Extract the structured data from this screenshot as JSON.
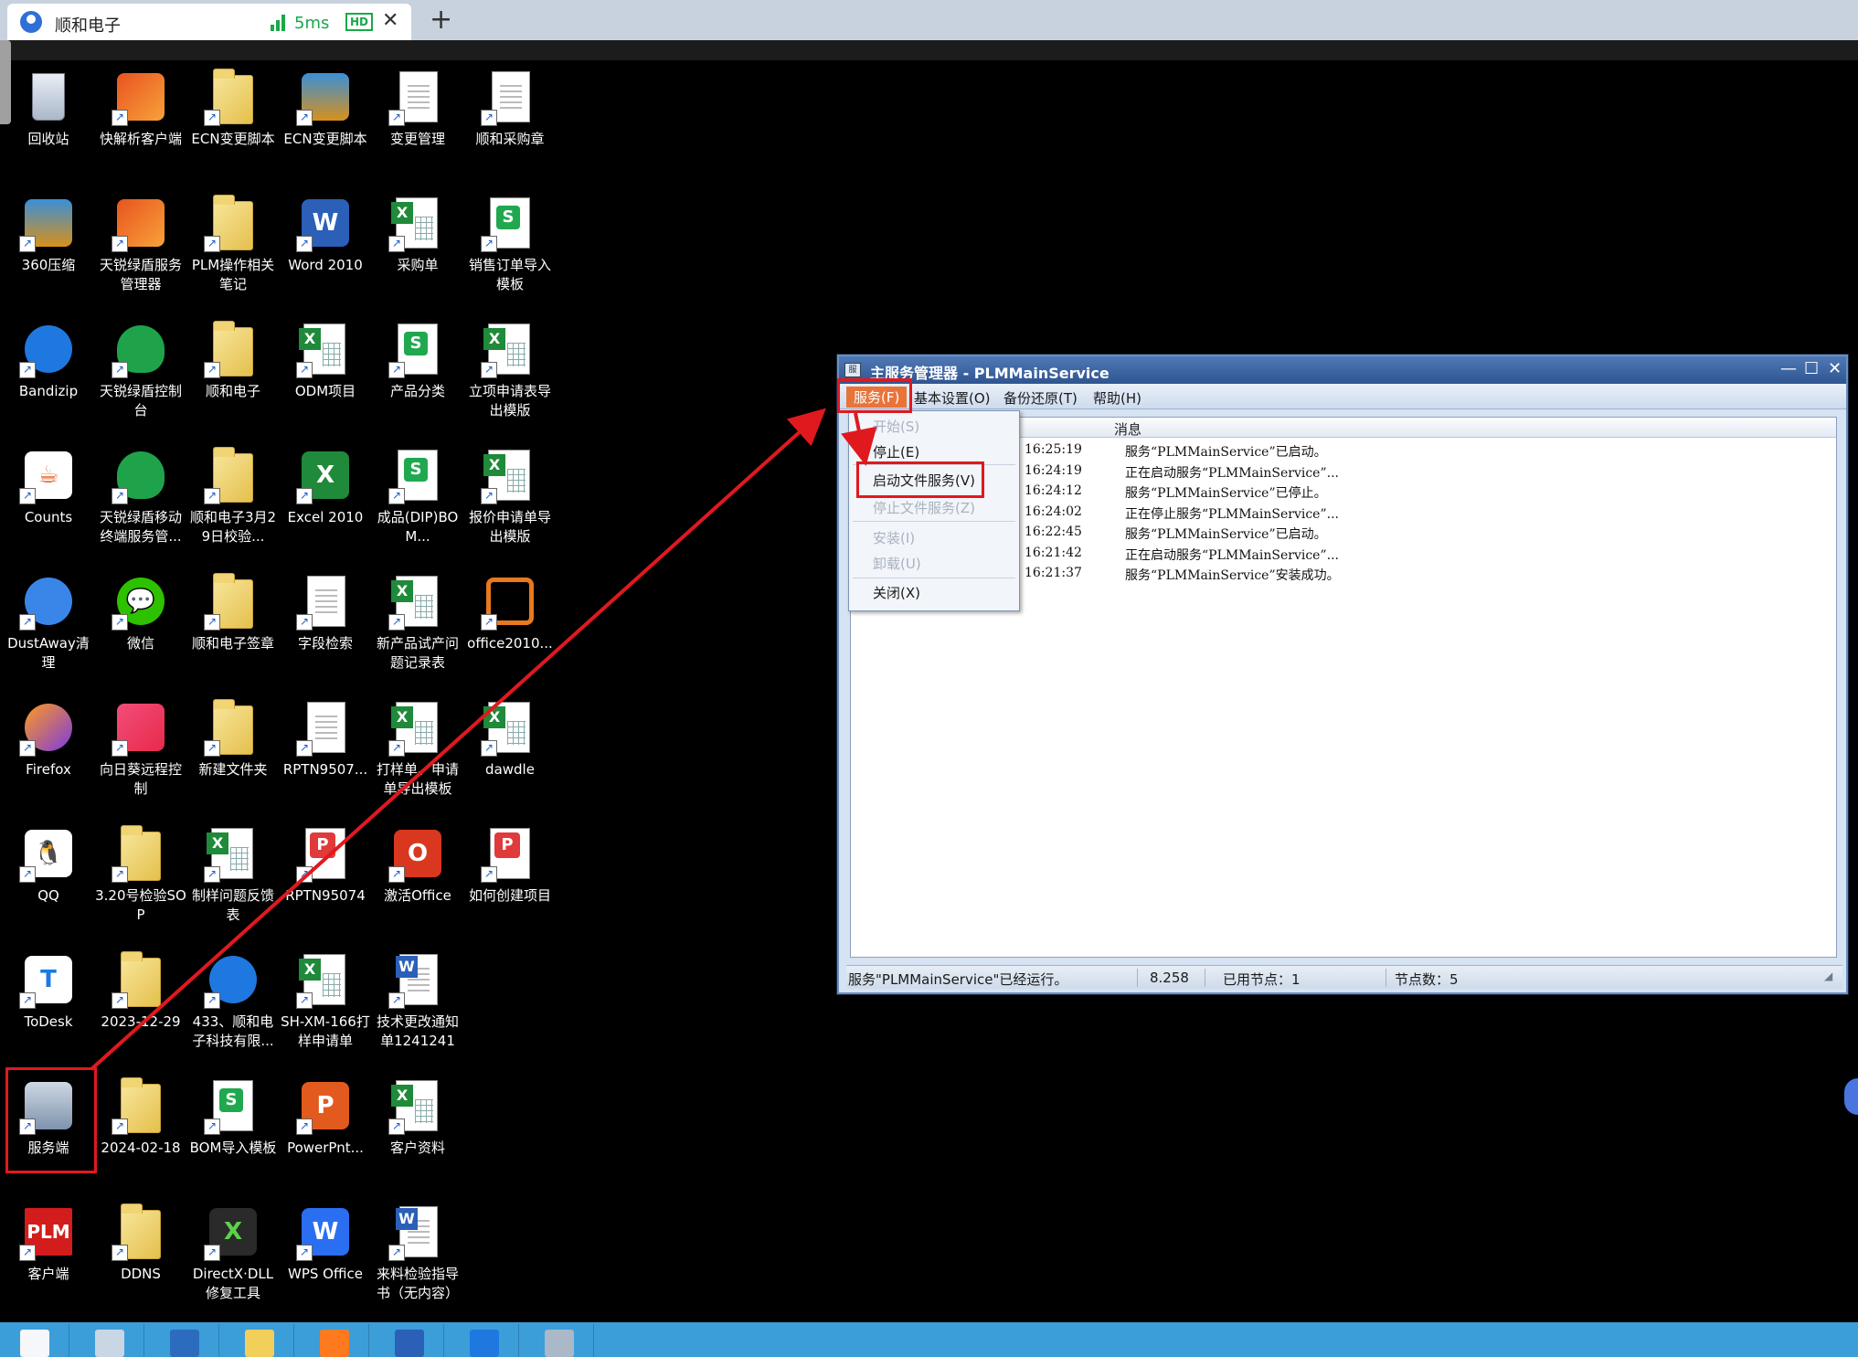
{
  "browser": {
    "tab_title": "顺和电子",
    "latency": "5ms",
    "hd_badge": "HD",
    "close_glyph": "✕",
    "new_tab_glyph": "+"
  },
  "desktop": {
    "icons": [
      {
        "label": "回收站",
        "type": "recycle"
      },
      {
        "label": "快解析客户端",
        "type": "app"
      },
      {
        "label": "ECN变更脚本",
        "type": "folder"
      },
      {
        "label": "ECN变更脚本",
        "type": "zip"
      },
      {
        "label": "变更管理",
        "type": "doc"
      },
      {
        "label": "顺和采购章",
        "type": "image"
      },
      {
        "label": "360压缩",
        "type": "zip"
      },
      {
        "label": "天锐绿盾服务管理器",
        "type": "app"
      },
      {
        "label": "PLM操作相关笔记",
        "type": "folder"
      },
      {
        "label": "Word 2010",
        "type": "word"
      },
      {
        "label": "采购单",
        "type": "xls"
      },
      {
        "label": "销售订单导入模板",
        "type": "wps"
      },
      {
        "label": "Bandizip",
        "type": "bandizip"
      },
      {
        "label": "天锐绿盾控制台",
        "type": "shield"
      },
      {
        "label": "顺和电子",
        "type": "folder"
      },
      {
        "label": "ODM项目",
        "type": "xls"
      },
      {
        "label": "产品分类",
        "type": "wps"
      },
      {
        "label": "立项申请表导出模版",
        "type": "xls"
      },
      {
        "label": "Counts",
        "type": "java"
      },
      {
        "label": "天锐绿盾移动终端服务管...",
        "type": "shield"
      },
      {
        "label": "顺和电子3月29日校验...",
        "type": "folder"
      },
      {
        "label": "Excel 2010",
        "type": "excel"
      },
      {
        "label": "成品(DIP)BOM...",
        "type": "wps"
      },
      {
        "label": "报价申请单导出模版",
        "type": "xls"
      },
      {
        "label": "DustAway清理",
        "type": "dust"
      },
      {
        "label": "微信",
        "type": "wechat"
      },
      {
        "label": "顺和电子签章",
        "type": "folder"
      },
      {
        "label": "字段检索",
        "type": "doc"
      },
      {
        "label": "新产品试产问题记录表",
        "type": "xls"
      },
      {
        "label": "office2010...",
        "type": "office2010"
      },
      {
        "label": "Firefox",
        "type": "firefox"
      },
      {
        "label": "向日葵远程控制",
        "type": "sunflower"
      },
      {
        "label": "新建文件夹",
        "type": "folder"
      },
      {
        "label": "RPTN9507...",
        "type": "blank"
      },
      {
        "label": "打样单、申请单导出模板",
        "type": "xls"
      },
      {
        "label": "dawdle",
        "type": "xls"
      },
      {
        "label": "QQ",
        "type": "qq"
      },
      {
        "label": "3.20号检验SOP",
        "type": "folder"
      },
      {
        "label": "制样问题反馈表",
        "type": "xls"
      },
      {
        "label": "RPTN95074",
        "type": "pdf"
      },
      {
        "label": "激活Office",
        "type": "office"
      },
      {
        "label": "如何创建项目",
        "type": "pdf"
      },
      {
        "label": "ToDesk",
        "type": "todesk"
      },
      {
        "label": "2023-12-29",
        "type": "folder"
      },
      {
        "label": "433、顺和电子科技有限...",
        "type": "bandizip"
      },
      {
        "label": "SH-XM-166打样申请单",
        "type": "xls"
      },
      {
        "label": "技术更改通知单1241241",
        "type": "worddoc"
      },
      {
        "label": "",
        "type": "none"
      },
      {
        "label": "服务端",
        "type": "server"
      },
      {
        "label": "2024-02-18",
        "type": "folder"
      },
      {
        "label": "BOM导入模板",
        "type": "wps"
      },
      {
        "label": "PowerPnt...",
        "type": "ppt"
      },
      {
        "label": "客户资料",
        "type": "xls"
      },
      {
        "label": "",
        "type": "none"
      },
      {
        "label": "客户端",
        "type": "plm"
      },
      {
        "label": "DDNS",
        "type": "folder"
      },
      {
        "label": "DirectX·DLL修复工具",
        "type": "directx"
      },
      {
        "label": "WPS Office",
        "type": "wpsoffice"
      },
      {
        "label": "来料检验指导书（无内容）",
        "type": "worddoc"
      },
      {
        "label": "",
        "type": "none"
      }
    ],
    "glyphs": {
      "plm": "PLM",
      "word": "W",
      "excel": "X",
      "qq": "🐧",
      "wechat": "💬",
      "java": "☕",
      "office": "O",
      "ppt": "P",
      "todesk": "T",
      "firefox": "🦊",
      "directx": "X",
      "wpsoffice": "W",
      "shortcut": "↗"
    }
  },
  "window": {
    "title": "主服务管理器 - PLMMainService",
    "title_icon": "服",
    "controls": {
      "minimize": "—",
      "maximize": "☐",
      "close": "✕"
    },
    "menu": [
      {
        "label": "服务(F)",
        "active": true
      },
      {
        "label": "基本设置(O)",
        "active": false
      },
      {
        "label": "备份还原(T)",
        "active": false
      },
      {
        "label": "帮助(H)",
        "active": false
      }
    ],
    "list": {
      "header_message": "消息",
      "rows": [
        {
          "time": "16:25:19",
          "message": "服务“PLMMainService”已启动。"
        },
        {
          "time": "16:24:19",
          "message": "正在启动服务“PLMMainService”..."
        },
        {
          "time": "16:24:12",
          "message": "服务“PLMMainService”已停止。"
        },
        {
          "time": "16:24:02",
          "message": "正在停止服务“PLMMainService”..."
        },
        {
          "time": "16:22:45",
          "message": "服务“PLMMainService”已启动。"
        },
        {
          "time": "16:21:42",
          "message": "正在启动服务“PLMMainService”..."
        },
        {
          "time": "16:21:37",
          "message": "服务“PLMMainService”安装成功。"
        }
      ]
    },
    "status": {
      "service_state": "服务\"PLMMainService\"已经运行。",
      "version": "8.258",
      "used_nodes": "已用节点：1",
      "node_count": "节点数：5",
      "grip": "◢"
    }
  },
  "dropdown": {
    "items": [
      {
        "label": "开始(S)",
        "disabled": true
      },
      {
        "label": "停止(E)",
        "disabled": false
      },
      {
        "label": "启动文件服务(V)",
        "disabled": false
      },
      {
        "label": "停止文件服务(Z)",
        "disabled": true
      },
      {
        "label": "安装(I)",
        "disabled": true
      },
      {
        "label": "卸载(U)",
        "disabled": true
      },
      {
        "label": "关闭(X)",
        "disabled": false
      }
    ]
  },
  "taskbar": {
    "items": [
      "start",
      "server-manager",
      "powershell",
      "file-explorer",
      "firefox",
      "word",
      "todesk",
      "server"
    ]
  },
  "colors": {
    "highlight": "#e0191f",
    "menu_active": "#e8743a",
    "taskbar": "#3b9ed9",
    "title_bar": "#2f5591",
    "latency": "#1aa84a"
  }
}
